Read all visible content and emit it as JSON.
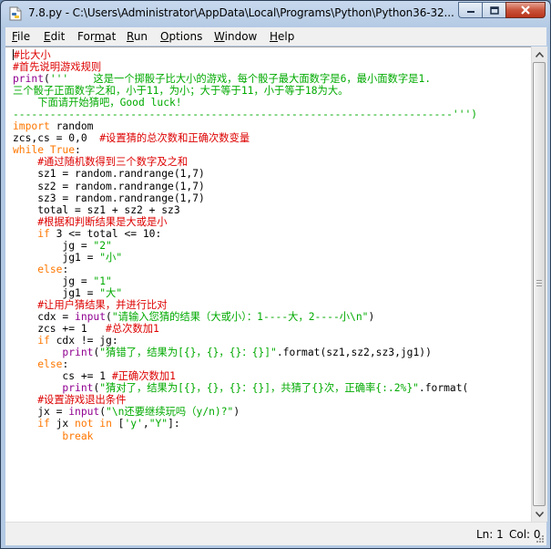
{
  "window": {
    "title": "7.8.py - C:\\Users\\Administrator\\AppData\\Local\\Programs\\Python\\Python36-32...",
    "icon": "python-file-icon",
    "controls": [
      "minimize-icon",
      "maximize-icon",
      "close-icon"
    ]
  },
  "menu": [
    {
      "first": "F",
      "rest": "ile"
    },
    {
      "first": "E",
      "rest": "dit"
    },
    {
      "first": "",
      "rest": "Format",
      "underline_index": 3
    },
    {
      "first": "R",
      "rest": "un"
    },
    {
      "first": "O",
      "rest": "ptions"
    },
    {
      "first": "W",
      "rest": "indow"
    },
    {
      "first": "H",
      "rest": "elp"
    }
  ],
  "menu_labels": [
    "File",
    "Edit",
    "Format",
    "Run",
    "Options",
    "Window",
    "Help"
  ],
  "code_lines": [
    [
      [
        "cm",
        "#比大小"
      ]
    ],
    [
      [
        "cm",
        "#首先说明游戏规则"
      ]
    ],
    [
      [
        "bi",
        "print"
      ],
      [
        "",
        "("
      ],
      [
        "st",
        "'''    这是一个掷骰子比大小的游戏，每个骰子最大面数字是6，最小面数字是1."
      ]
    ],
    [
      [
        "st",
        "三个骰子正面数字之和，小于11，为小；大于等于11，小于等于18为大。"
      ]
    ],
    [
      [
        "st",
        "    下面请开始猜吧，Good luck!"
      ]
    ],
    [
      [
        "st",
        "-----------------------------------------------------------------------''')"
      ]
    ],
    [
      [
        "kw",
        "import"
      ],
      [
        "",
        " random"
      ]
    ],
    [
      [
        "",
        "zcs,cs = 0,0  "
      ],
      [
        "cm",
        "#设置猜的总次数和正确次数变量"
      ]
    ],
    [
      [
        "kw",
        "while"
      ],
      [
        "",
        " "
      ],
      [
        "kw",
        "True"
      ],
      [
        "",
        ":"
      ]
    ],
    [
      [
        "",
        "    "
      ],
      [
        "cm",
        "#通过随机数得到三个数字及之和"
      ]
    ],
    [
      [
        "",
        "    sz1 = random.randrange(1,7)"
      ]
    ],
    [
      [
        "",
        "    sz2 = random.randrange(1,7)"
      ]
    ],
    [
      [
        "",
        "    sz3 = random.randrange(1,7)"
      ]
    ],
    [
      [
        "",
        "    total = sz1 + sz2 + sz3"
      ]
    ],
    [
      [
        "",
        "    "
      ],
      [
        "cm",
        "#根据和判断结果是大或是小"
      ]
    ],
    [
      [
        "",
        "    "
      ],
      [
        "kw",
        "if"
      ],
      [
        "",
        " 3 <= total <= 10:"
      ]
    ],
    [
      [
        "",
        "        jg = "
      ],
      [
        "st",
        "\"2\""
      ]
    ],
    [
      [
        "",
        "        jg1 = "
      ],
      [
        "st",
        "\"小\""
      ]
    ],
    [
      [
        "",
        "    "
      ],
      [
        "kw",
        "else"
      ],
      [
        "",
        ":"
      ]
    ],
    [
      [
        "",
        "        jg = "
      ],
      [
        "st",
        "\"1\""
      ]
    ],
    [
      [
        "",
        "        jg1 = "
      ],
      [
        "st",
        "\"大\""
      ]
    ],
    [
      [
        "",
        "    "
      ],
      [
        "cm",
        "#让用户猜结果，并进行比对"
      ]
    ],
    [
      [
        "",
        "    cdx = "
      ],
      [
        "bi",
        "input"
      ],
      [
        "",
        "("
      ],
      [
        "st",
        "\"请输入您猜的结果（大或小）：1----大，2----小\\n\""
      ],
      [
        "",
        ")"
      ]
    ],
    [
      [
        "",
        "    zcs += 1   "
      ],
      [
        "cm",
        "#总次数加1"
      ]
    ],
    [
      [
        "",
        "    "
      ],
      [
        "kw",
        "if"
      ],
      [
        "",
        " cdx != jg:"
      ]
    ],
    [
      [
        "",
        "        "
      ],
      [
        "bi",
        "print"
      ],
      [
        "",
        "("
      ],
      [
        "st",
        "\"猜错了，结果为[{}，{}，{}：{}]\""
      ],
      [
        "",
        ".format(sz1,sz2,sz3,jg1))"
      ]
    ],
    [
      [
        "",
        "    "
      ],
      [
        "kw",
        "else"
      ],
      [
        "",
        ":"
      ]
    ],
    [
      [
        "",
        "        cs += 1 "
      ],
      [
        "cm",
        "#正确次数加1"
      ]
    ],
    [
      [
        "",
        "        "
      ],
      [
        "bi",
        "print"
      ],
      [
        "",
        "("
      ],
      [
        "st",
        "\"猜对了，结果为[{}，{}，{}：{}]，共猜了{}次，正确率{:.2%}\""
      ],
      [
        "",
        ".format("
      ]
    ],
    [
      [
        "",
        "    "
      ],
      [
        "cm",
        "#设置游戏退出条件"
      ]
    ],
    [
      [
        "",
        "    jx = "
      ],
      [
        "bi",
        "input"
      ],
      [
        "",
        "("
      ],
      [
        "st",
        "\"\\n还要继续玩吗（y/n)?\""
      ],
      [
        "",
        ")"
      ]
    ],
    [
      [
        "",
        "    "
      ],
      [
        "kw",
        "if"
      ],
      [
        "",
        " jx "
      ],
      [
        "kw",
        "not"
      ],
      [
        "",
        " "
      ],
      [
        "kw",
        "in"
      ],
      [
        "",
        " ["
      ],
      [
        "st",
        "'y'"
      ],
      [
        "",
        ","
      ],
      [
        "st",
        "\"Y\""
      ],
      [
        "",
        "]:"
      ]
    ],
    [
      [
        "",
        "        "
      ],
      [
        "kw",
        "break"
      ]
    ]
  ],
  "status": {
    "line": "Ln: 1",
    "col": "Col: 0"
  },
  "colors": {
    "keyword": "#ff7700",
    "builtin": "#900090",
    "string": "#00aa00",
    "comment": "#dd0000"
  }
}
